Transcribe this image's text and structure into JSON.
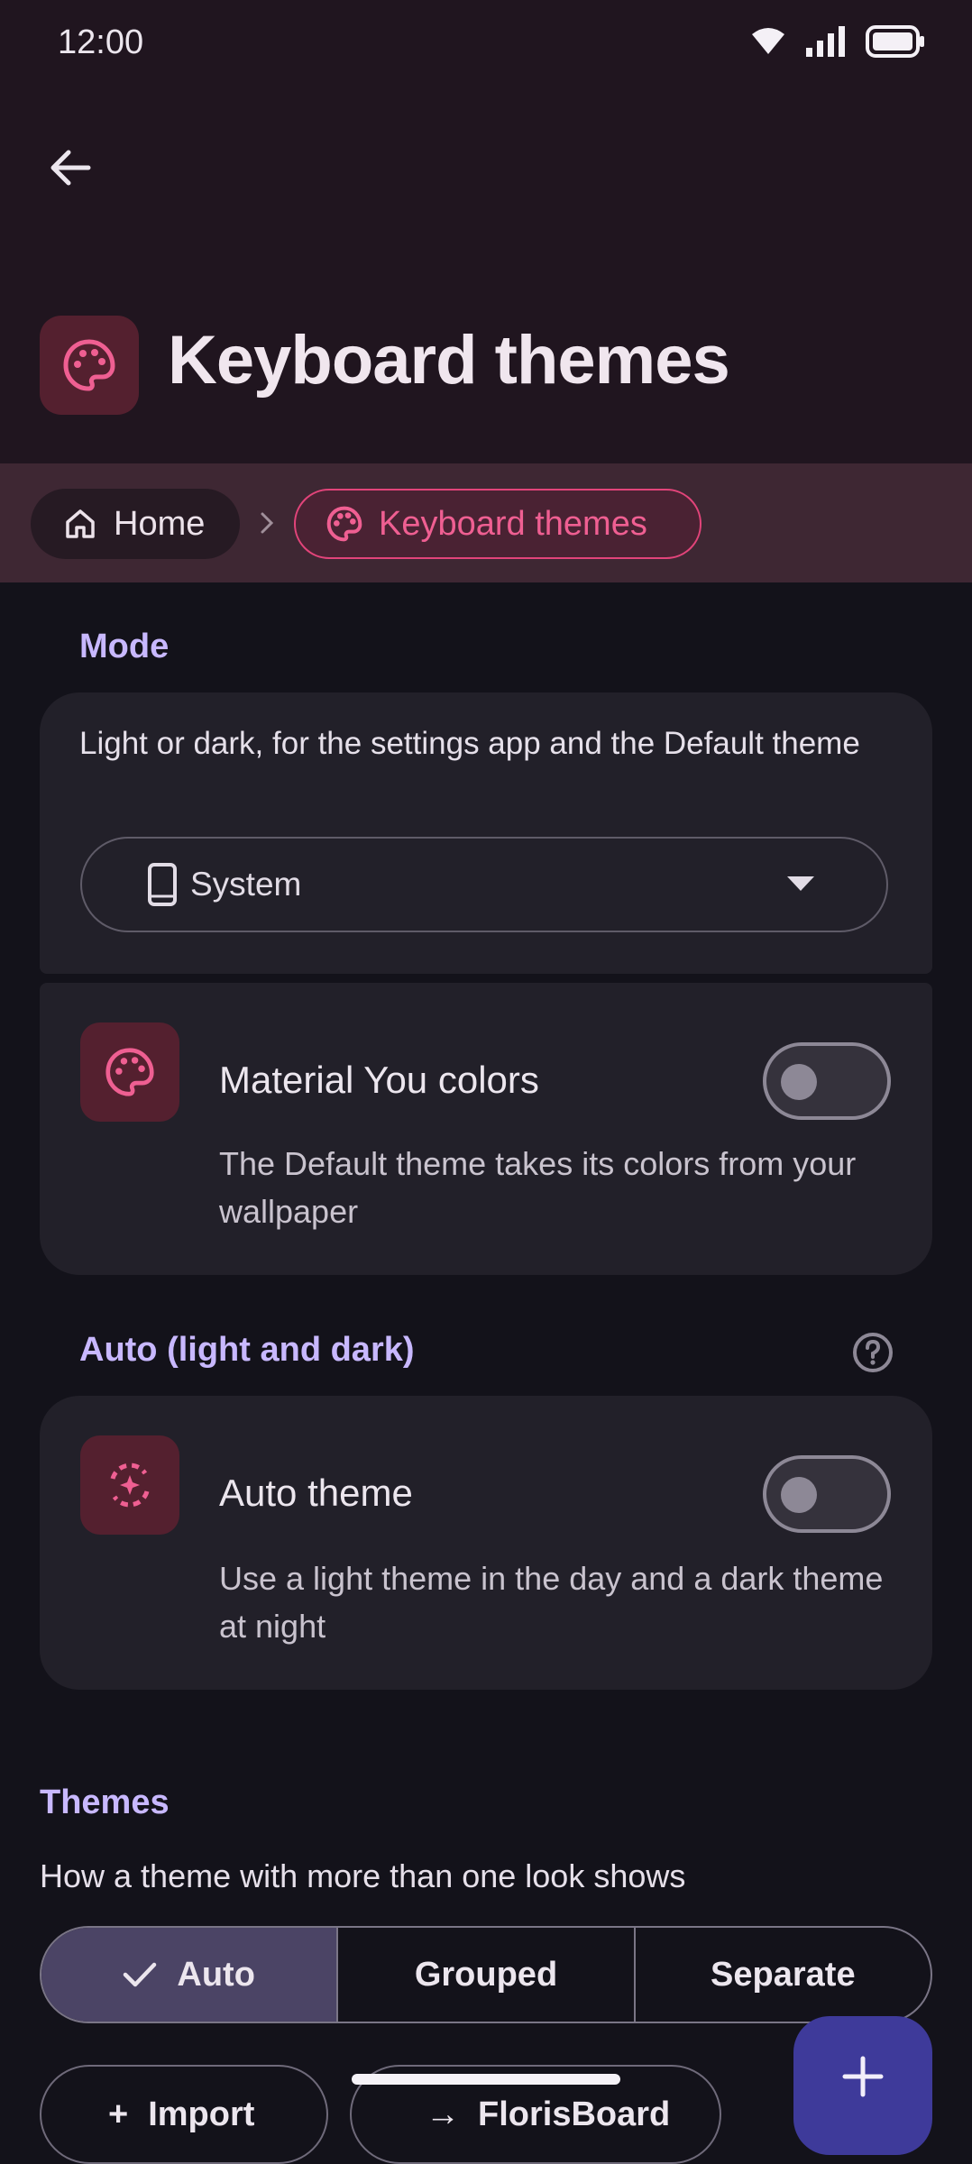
{
  "status": {
    "time": "12:00"
  },
  "header": {
    "back_icon": "arrow-left-icon",
    "title_icon": "palette-icon",
    "title": "Keyboard themes"
  },
  "breadcrumb": {
    "home": "Home",
    "current": "Keyboard themes"
  },
  "mode": {
    "label": "Mode",
    "description": "Light or dark, for the settings app and the Default theme",
    "dropdown_value": "System",
    "material_title": "Material You colors",
    "material_sub": "The Default theme takes its colors from your wallpaper",
    "material_on": false
  },
  "auto": {
    "label": "Auto (light and dark)",
    "title": "Auto theme",
    "sub": "Use a light theme in the day and a dark theme at night",
    "on": false
  },
  "themes": {
    "label": "Themes",
    "description": "How a theme with more than one look shows",
    "segments": [
      "Auto",
      "Grouped",
      "Separate"
    ],
    "selected": "Auto",
    "import_label": "Import",
    "florisboard_label": "FlorisBoard"
  },
  "fab_icon": "plus-icon",
  "colors": {
    "accent": "#e2447a",
    "section": "#c8b8ff",
    "fab": "#3e3a9a"
  }
}
